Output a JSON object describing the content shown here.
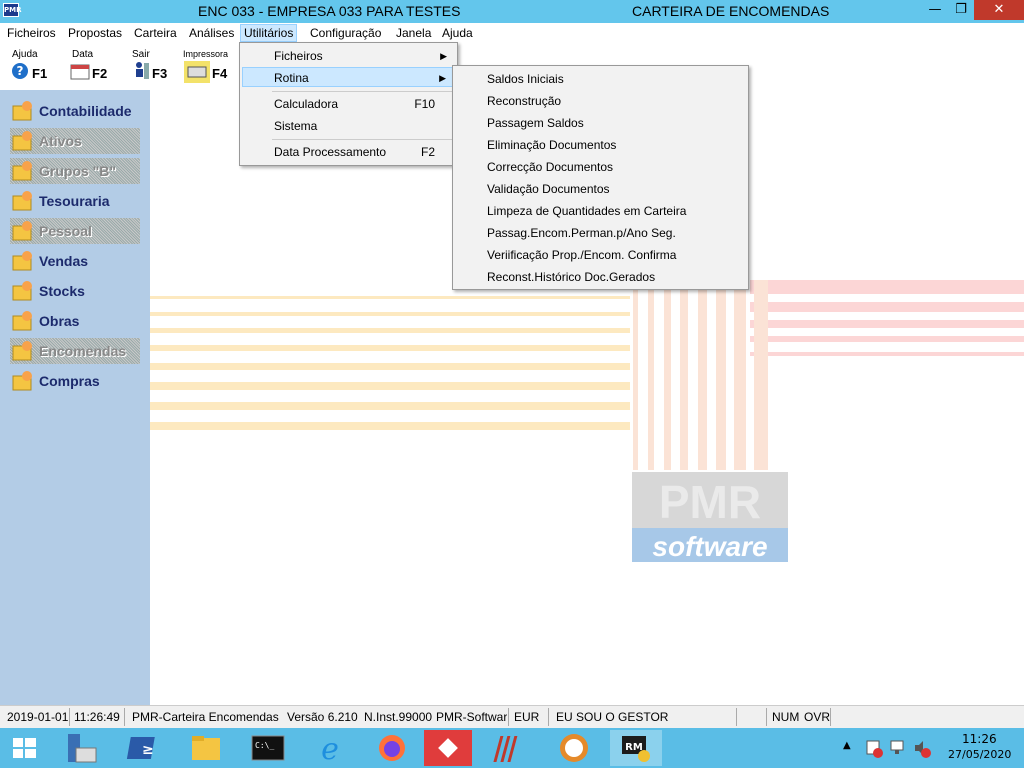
{
  "window": {
    "app_icon_text": "PMR",
    "title_left": "ENC 033 - EMPRESA 033 PARA TESTES",
    "title_right": "CARTEIRA DE ENCOMENDAS",
    "minimize": "—",
    "restore": "❐",
    "close": "✕"
  },
  "menubar": [
    "Ficheiros",
    "Propostas",
    "Carteira",
    "Análises",
    "Utilitários",
    "Configuração",
    "Janela",
    "Ajuda"
  ],
  "toolbar": [
    {
      "label": "Ajuda",
      "key": "F1"
    },
    {
      "label": "Data",
      "key": "F2"
    },
    {
      "label": "Sair",
      "key": "F3"
    },
    {
      "label": "Impressora",
      "key": "F4"
    }
  ],
  "sidebar": [
    {
      "label": "Contabilidade",
      "enabled": true
    },
    {
      "label": "Ativos",
      "enabled": false
    },
    {
      "label": "Grupos \"B\"",
      "enabled": false
    },
    {
      "label": "Tesouraria",
      "enabled": true
    },
    {
      "label": "Pessoal",
      "enabled": false
    },
    {
      "label": "Vendas",
      "enabled": true
    },
    {
      "label": "Stocks",
      "enabled": true
    },
    {
      "label": "Obras",
      "enabled": true
    },
    {
      "label": "Encomendas",
      "enabled": false
    },
    {
      "label": "Compras",
      "enabled": true
    }
  ],
  "utilitarios_menu": [
    {
      "label": "Ficheiros",
      "key": "",
      "submenu": true
    },
    {
      "label": "Rotina",
      "key": "",
      "submenu": true,
      "highlighted": true
    },
    {
      "label": "Calculadora",
      "key": "F10"
    },
    {
      "label": "Sistema",
      "key": ""
    },
    {
      "label": "Data Processamento",
      "key": "F2"
    }
  ],
  "rotina_submenu": [
    "Saldos Iniciais",
    "Reconstrução",
    "Passagem Saldos",
    "Eliminação Documentos",
    "Correcção Documentos",
    "Validação Documentos",
    "Limpeza de Quantidades em Carteira",
    "Passag.Encom.Perman.p/Ano Seg.",
    "Veriificação Prop./Encom. Confirma",
    "Reconst.Histórico Doc.Gerados"
  ],
  "logo": {
    "text1": "PMR",
    "text2": "software"
  },
  "statusbar": {
    "date": "2019-01-01",
    "time": "11:26:49",
    "module": "PMR-Carteira Encomendas",
    "version": "Versão  6.210",
    "instance": "N.Inst.99000",
    "company": "PMR-Softwar",
    "currency": "EUR",
    "user": "EU SOU O GESTOR",
    "num": "NUM",
    "ovr": "OVR"
  },
  "clock": {
    "time": "11:26",
    "date": "27/05/2020"
  },
  "colors": {
    "titlebar": "#63c6ec",
    "sidebar": "#b3cce6",
    "taskbar": "#5abde6",
    "highlight": "#cce8ff"
  }
}
